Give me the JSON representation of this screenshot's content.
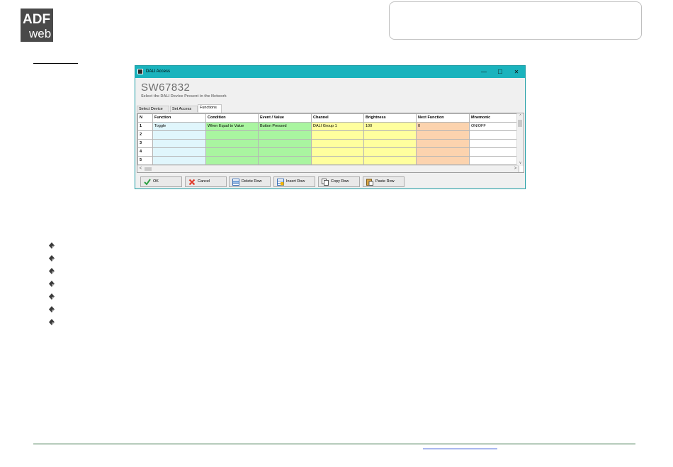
{
  "logo": {
    "text_top": "ADF",
    "text_bottom": "web"
  },
  "window": {
    "title": "DALI Access",
    "controls": {
      "minimize": "—",
      "maximize": "☐",
      "close": "✕"
    },
    "product_name": "SW67832",
    "subtitle": "Select the DALI Device Present in the Network"
  },
  "tabs": [
    {
      "label": "Select Device",
      "active": false
    },
    {
      "label": "Set Access",
      "active": false
    },
    {
      "label": "Functions",
      "active": true
    }
  ],
  "grid": {
    "columns": [
      "N",
      "Function",
      "Condition",
      "Event / Value",
      "Channel",
      "Brightness",
      "Next Function",
      "Mnemonic"
    ],
    "rows": [
      [
        "1",
        "Toggle",
        "When Equal to Value",
        "Button Pressed",
        "DALI Group 1",
        "100",
        "0",
        "ON/OFF"
      ],
      [
        "2",
        "",
        "",
        "",
        "",
        "",
        "",
        ""
      ],
      [
        "3",
        "",
        "",
        "",
        "",
        "",
        "",
        ""
      ],
      [
        "4",
        "",
        "",
        "",
        "",
        "",
        "",
        ""
      ],
      [
        "5",
        "",
        "",
        "",
        "",
        "",
        "",
        ""
      ],
      [
        "",
        "",
        "",
        "",
        "",
        "",
        "",
        ""
      ]
    ],
    "scroll": {
      "up": "^",
      "down": "v",
      "left": "<",
      "right": ">"
    }
  },
  "buttons": {
    "ok": "OK",
    "cancel": "Cancel",
    "delete_row": "Delete Row",
    "insert_row": "Insert Row",
    "copy_row": "Copy Row",
    "paste_row": "Paste Row"
  },
  "colors": {
    "titlebar": "#1ab3bd",
    "function_col": "#e0f6fc",
    "condition_col": "#a9f5a0",
    "channel_col": "#ffff9e",
    "next_function_col": "#fcd3ae",
    "footer_line": "#2f6b3e",
    "link": "#2447d4"
  },
  "bullets": [
    "",
    "",
    "",
    "",
    "",
    "",
    ""
  ],
  "icons": {
    "ok": "check-icon",
    "cancel": "x-icon",
    "delete_row": "delete-row-icon",
    "insert_row": "insert-row-icon",
    "copy_row": "copy-icon",
    "paste_row": "paste-icon",
    "bullet": "diamond-bullet-icon"
  }
}
